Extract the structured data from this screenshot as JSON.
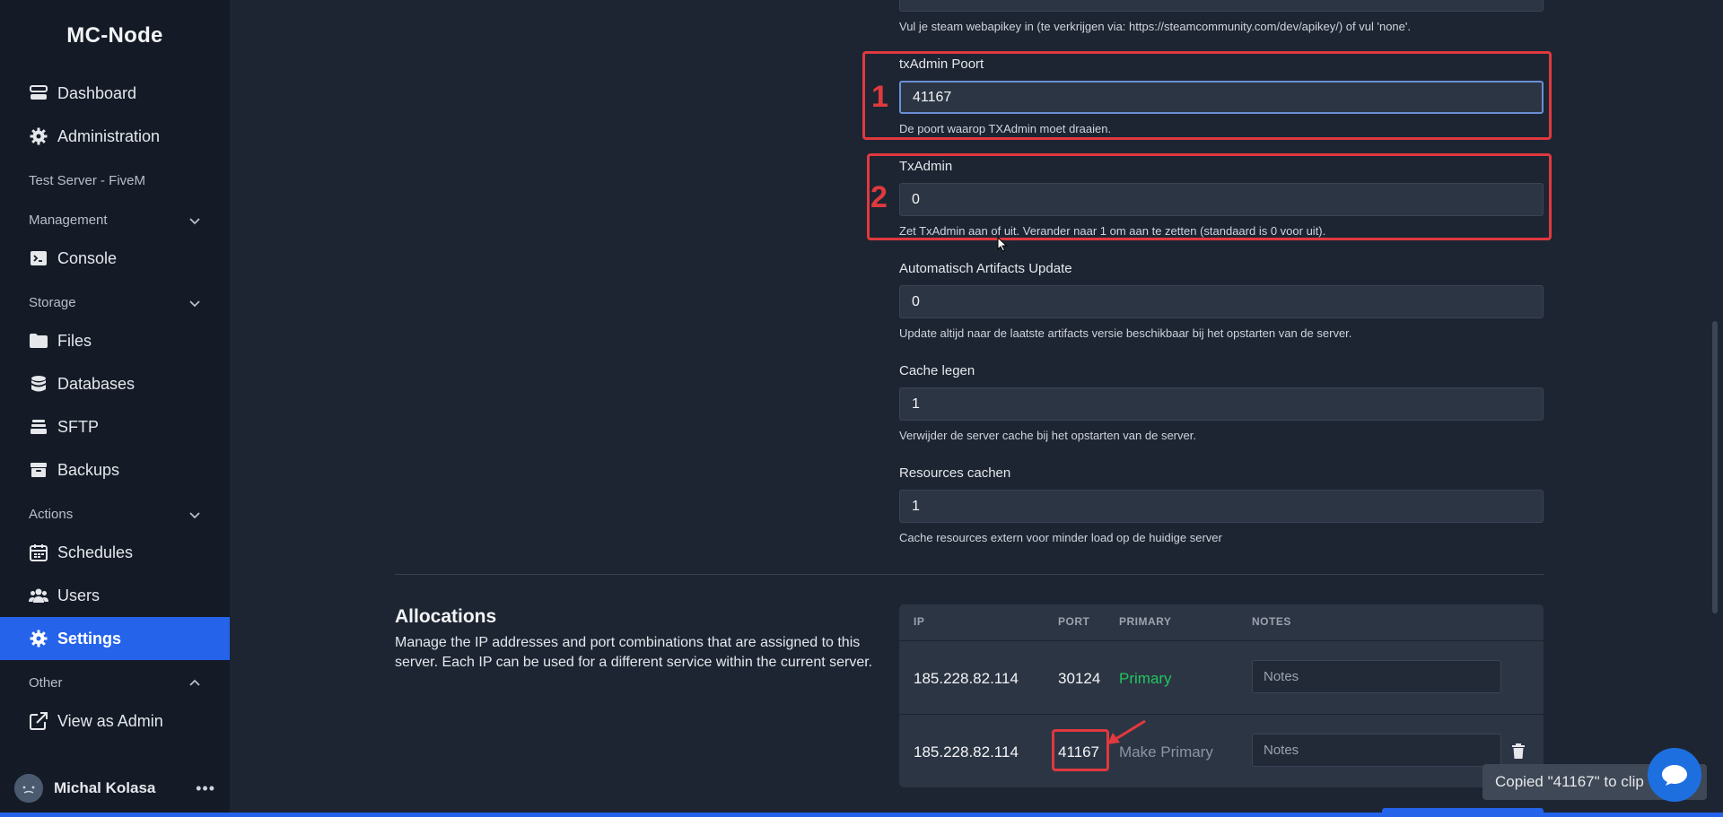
{
  "sidebar": {
    "brand": "MC-Node",
    "items": {
      "dashboard": "Dashboard",
      "administration": "Administration",
      "console": "Console",
      "files": "Files",
      "databases": "Databases",
      "sftp": "SFTP",
      "backups": "Backups",
      "schedules": "Schedules",
      "users": "Users",
      "settings": "Settings",
      "view_as_admin": "View as Admin"
    },
    "server_name": "Test Server - FiveM",
    "sections": {
      "management": "Management",
      "storage": "Storage",
      "actions": "Actions",
      "other": "Other"
    },
    "user": {
      "name": "Michal Kolasa",
      "menu": "•••"
    }
  },
  "variables": {
    "steam_help": "Vul je steam webapikey in (te verkrijgen via: https://steamcommunity.com/dev/apikey/) of vul 'none'.",
    "txadmin_port": {
      "label": "txAdmin Poort",
      "value": "41167",
      "help": "De poort waarop TXAdmin moet draaien."
    },
    "txadmin": {
      "label": "TxAdmin",
      "value": "0",
      "help": "Zet TxAdmin aan of uit. Verander naar 1 om aan te zetten (standaard is 0 voor uit)."
    },
    "artifacts": {
      "label": "Automatisch Artifacts Update",
      "value": "0",
      "help": "Update altijd naar de laatste artifacts versie beschikbaar bij het opstarten van de server."
    },
    "cache": {
      "label": "Cache legen",
      "value": "1",
      "help": "Verwijder de server cache bij het opstarten van de server."
    },
    "resources": {
      "label": "Resources cachen",
      "value": "1",
      "help": "Cache resources extern voor minder load op de huidige server"
    }
  },
  "annotations": {
    "one": "1",
    "two": "2",
    "color": "#e0393e"
  },
  "allocations": {
    "title": "Allocations",
    "description": "Manage the IP addresses and port combinations that are assigned to this server. Each IP can be used for a different service within the current server.",
    "headers": {
      "ip": "IP",
      "port": "PORT",
      "primary": "PRIMARY",
      "notes": "NOTES"
    },
    "rows": [
      {
        "ip": "185.228.82.114",
        "port": "30124",
        "primary": "Primary",
        "notes_placeholder": "Notes"
      },
      {
        "ip": "185.228.82.114",
        "port": "41167",
        "primary": "Make Primary",
        "notes_placeholder": "Notes"
      }
    ]
  },
  "toast": {
    "text": "Copied \"41167\" to clip"
  },
  "colors": {
    "accent": "#2563eb",
    "primary_green": "#22c55e",
    "background": "#1d2533",
    "sidebar": "#141b27"
  }
}
